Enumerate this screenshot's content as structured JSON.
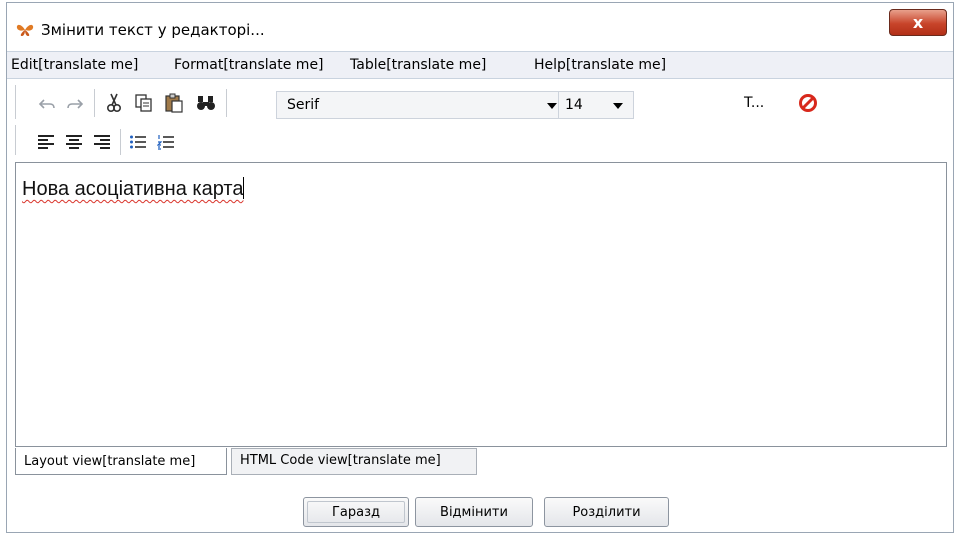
{
  "window": {
    "title": "Змінити текст у редакторі...",
    "close_label": "x"
  },
  "menubar": {
    "items": [
      {
        "label": "Edit[translate me]"
      },
      {
        "label": "Format[translate me]"
      },
      {
        "label": "Table[translate me]"
      },
      {
        "label": "Help[translate me]"
      }
    ]
  },
  "toolbar": {
    "font_family": "Serif",
    "font_size": "14",
    "text_style_label": "T...",
    "icons": [
      "undo-icon",
      "redo-icon",
      "cut-icon",
      "copy-icon",
      "paste-icon",
      "find-icon",
      "no-symbol-icon",
      "align-left-icon",
      "align-center-icon",
      "align-right-icon",
      "bullet-list-icon",
      "numbered-list-icon"
    ]
  },
  "editor": {
    "content": "Нова асоціативна карта"
  },
  "tabs": [
    {
      "label": "Layout view[translate me]"
    },
    {
      "label": "HTML Code view[translate me]"
    }
  ],
  "buttons": {
    "ok": "Гаразд",
    "cancel": "Відмінити",
    "split": "Розділити"
  },
  "colors": {
    "close_button": "#c8442a",
    "menubar_bg": "#eef0f6",
    "spellcheck": "#d9342b"
  }
}
